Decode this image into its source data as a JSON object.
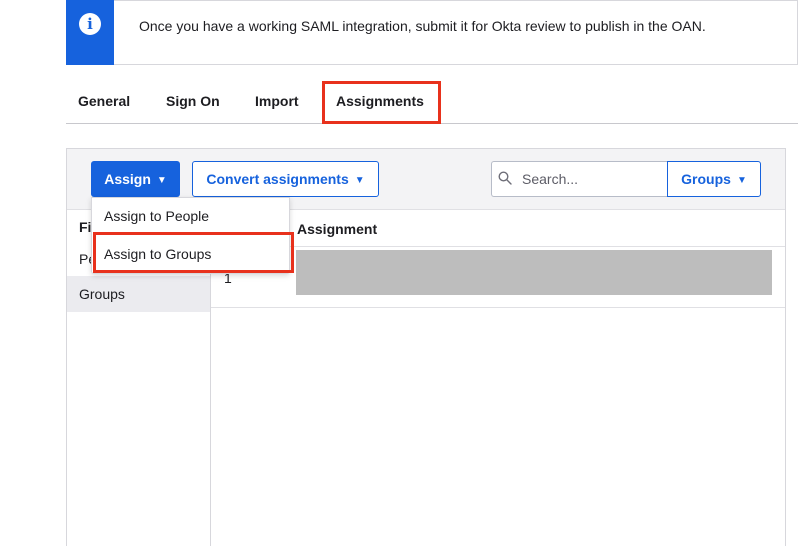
{
  "banner": {
    "message": "Once you have a working SAML integration, submit it for Okta review to publish in the OAN.",
    "icon": "info-icon"
  },
  "tabs": [
    {
      "label": "General"
    },
    {
      "label": "Sign On"
    },
    {
      "label": "Import"
    },
    {
      "label": "Assignments",
      "active": true
    }
  ],
  "toolbar": {
    "assign_label": "Assign",
    "convert_label": "Convert assignments",
    "search_placeholder": "Search...",
    "filter_select_label": "Groups"
  },
  "assign_menu": {
    "items": [
      {
        "label": "Assign to People"
      },
      {
        "label": "Assign to Groups",
        "highlighted": true
      }
    ]
  },
  "sidebar": {
    "filter_label": "Fi",
    "items": [
      {
        "label": "Pe"
      },
      {
        "label": "Groups",
        "selected": true
      }
    ]
  },
  "table": {
    "column_assignment": "Assignment",
    "rows": [
      {
        "index": "1"
      }
    ]
  },
  "colors": {
    "primary": "#1662dd",
    "highlight": "#e8311c",
    "redaction": "#bdbdbd"
  }
}
